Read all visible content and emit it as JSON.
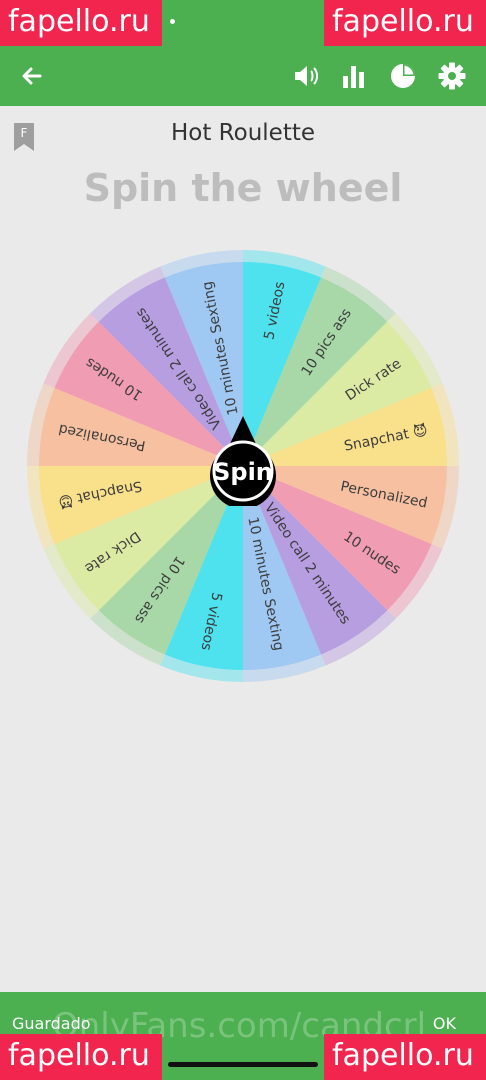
{
  "watermarks": {
    "top_left": "fapello.ru",
    "top_right": "fapello.ru",
    "bottom_left": "fapello.ru",
    "bottom_right": "fapello.ru"
  },
  "app_bar": {
    "icons": [
      "back-arrow-icon",
      "volume-icon",
      "bar-chart-icon",
      "pie-chart-icon",
      "gear-icon"
    ]
  },
  "header": {
    "bookmark": "F",
    "title": "Hot Roulette",
    "subtitle": "Spin the wheel"
  },
  "wheel": {
    "segments": [
      {
        "label": "5 videos",
        "color": "#4ee2ef"
      },
      {
        "label": "10 pics ass",
        "color": "#a8d8a8"
      },
      {
        "label": "Dick rate",
        "color": "#dbeba4"
      },
      {
        "label": "Snapchat 😈",
        "color": "#f9e08a"
      },
      {
        "label": "Personalized",
        "color": "#f7c0a0"
      },
      {
        "label": "10 nudes",
        "color": "#f09cb2"
      },
      {
        "label": "Video call 2 minutes",
        "color": "#b79ee0"
      },
      {
        "label": "10 minutes Sexting",
        "color": "#9fc8f2"
      },
      {
        "label": "5 videos",
        "color": "#4ee2ef"
      },
      {
        "label": "10 pics ass",
        "color": "#a8d8a8"
      },
      {
        "label": "Dick rate",
        "color": "#dbeba4"
      },
      {
        "label": "Snapchat 😈",
        "color": "#f9e08a"
      },
      {
        "label": "Personalized",
        "color": "#f7c0a0"
      },
      {
        "label": "10 nudes",
        "color": "#f09cb2"
      },
      {
        "label": "Video call 2 minutes",
        "color": "#b79ee0"
      },
      {
        "label": "10 minutes Sexting",
        "color": "#9fc8f2"
      }
    ],
    "spin_label": "Spin"
  },
  "bottom_bar": {
    "left_label": "Guardado",
    "right_label": "OK",
    "overlay_text": "OnlyFans.com/candcrl"
  },
  "colors": {
    "accent": "#4caf50",
    "watermark": "#f2254e"
  }
}
